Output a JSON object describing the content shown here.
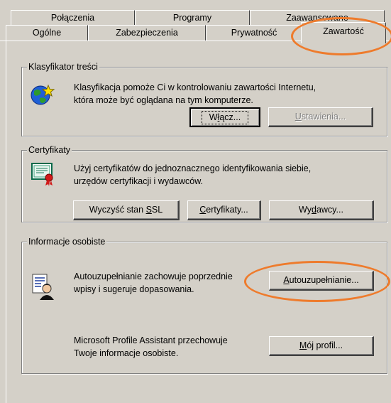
{
  "tabs": {
    "back_row": [
      "Połączenia",
      "Programy",
      "Zaawansowane"
    ],
    "front_row": [
      "Ogólne",
      "Zabezpieczenia",
      "Prywatność"
    ],
    "active": "Zawartość"
  },
  "content_advisor": {
    "title": "Klasyfikator treści",
    "line1": "Klasyfikacja pomoże Ci w kontrolowaniu zawartości Internetu,",
    "line2": "która może być oglądana na tym komputerze.",
    "enable_pre": "W",
    "enable_u": "ł",
    "enable_post": "ącz...",
    "settings_u": "U",
    "settings_post": "stawienia..."
  },
  "certificates": {
    "title": "Certyfikaty",
    "line1": "Użyj certyfikatów do jednoznacznego identyfikowania siebie,",
    "line2": "urzędów certyfikacji i wydawców.",
    "clear_pre": "Wyczyść stan ",
    "clear_u": "S",
    "clear_post": "SL",
    "certs_u": "C",
    "certs_post": "ertyfikaty...",
    "publishers_pre": "Wy",
    "publishers_u": "d",
    "publishers_post": "awcy..."
  },
  "personal": {
    "title": "Informacje osobiste",
    "autocomplete_line1": "Autouzupełnianie zachowuje poprzednie",
    "autocomplete_line2": "wpisy i sugeruje dopasowania.",
    "autocomplete_u": "A",
    "autocomplete_post": "utouzupełnianie...",
    "profile_line1": "Microsoft Profile Assistant przechowuje",
    "profile_line2": "Twoje informacje osobiste.",
    "profile_u": "M",
    "profile_post": "ój profil..."
  },
  "annotation_color": "#ee7b2c"
}
